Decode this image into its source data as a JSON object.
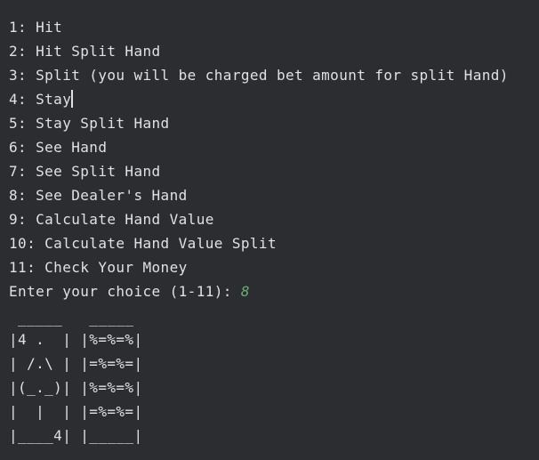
{
  "menu": {
    "items": [
      "1: Hit",
      "2: Hit Split Hand",
      "3: Split (you will be charged bet amount for split Hand)",
      "4: Stay",
      "5: Stay Split Hand",
      "6: See Hand",
      "7: See Split Hand",
      "8: See Dealer's Hand",
      "9: Calculate Hand Value",
      "10: Calculate Hand Value Split",
      "11: Check Your Money"
    ]
  },
  "prompt": {
    "text": "Enter your choice (1-11): ",
    "input_value": "8"
  },
  "cards": {
    "lines": [
      " _____   _____",
      "|4 .  | |%=%=%|",
      "| /.\\ | |=%=%=|",
      "|(_._)| |%=%=%|",
      "|  |  | |=%=%=|",
      "|____4| |_____|"
    ]
  },
  "colors": {
    "background": "#2b2d30",
    "text": "#dfe1e5",
    "input": "#6aab73"
  }
}
